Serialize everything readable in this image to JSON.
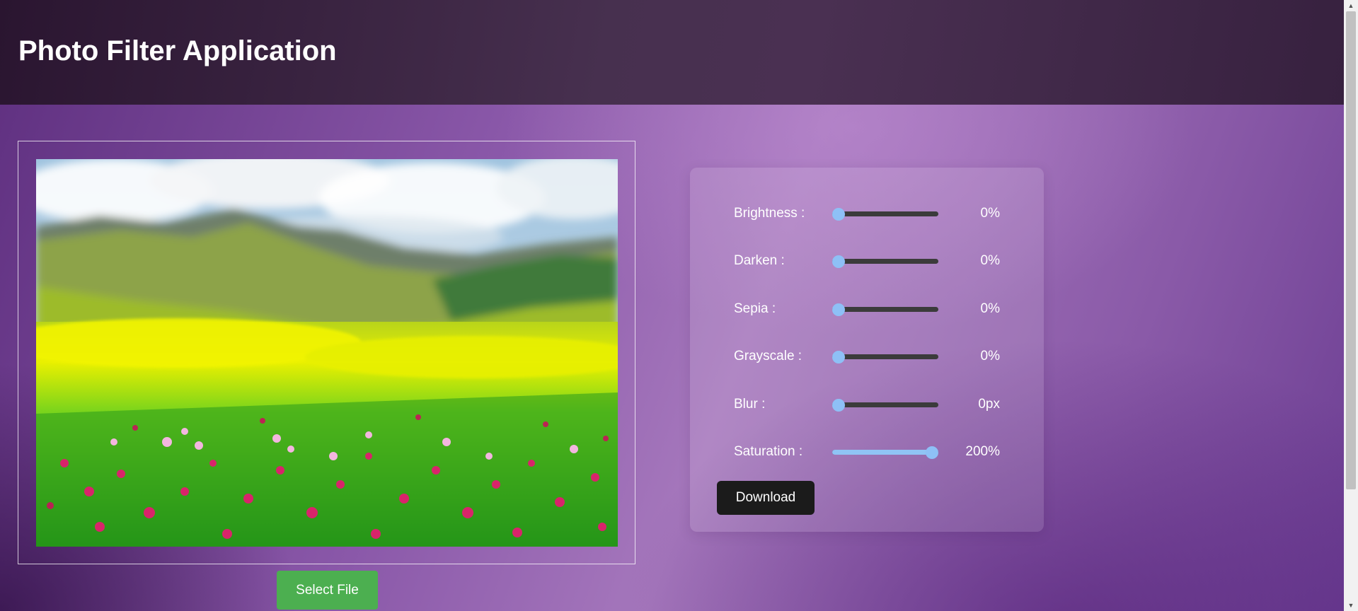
{
  "header": {
    "title": "Photo Filter Application"
  },
  "image": {
    "alt": "Meadow with pink wildflowers, green grass and hills under cloudy sky"
  },
  "controls": [
    {
      "label": "Brightness :",
      "value": "0%",
      "level": 0
    },
    {
      "label": "Darken :",
      "value": "0%",
      "level": 0
    },
    {
      "label": "Sepia :",
      "value": "0%",
      "level": 0
    },
    {
      "label": "Grayscale :",
      "value": "0%",
      "level": 0
    },
    {
      "label": "Blur :",
      "value": "0px",
      "level": 0
    },
    {
      "label": "Saturation :",
      "value": "200%",
      "level": 1
    }
  ],
  "buttons": {
    "download": "Download",
    "select_file": "Select File"
  },
  "colors": {
    "select_file_bg": "#4caf50",
    "download_bg": "#1b1b1b",
    "slider_thumb": "#8ec0f6",
    "slider_track": "#3b3b3b"
  },
  "icons": {
    "scroll_up": "triangle-up-icon",
    "scroll_down": "triangle-down-icon"
  }
}
